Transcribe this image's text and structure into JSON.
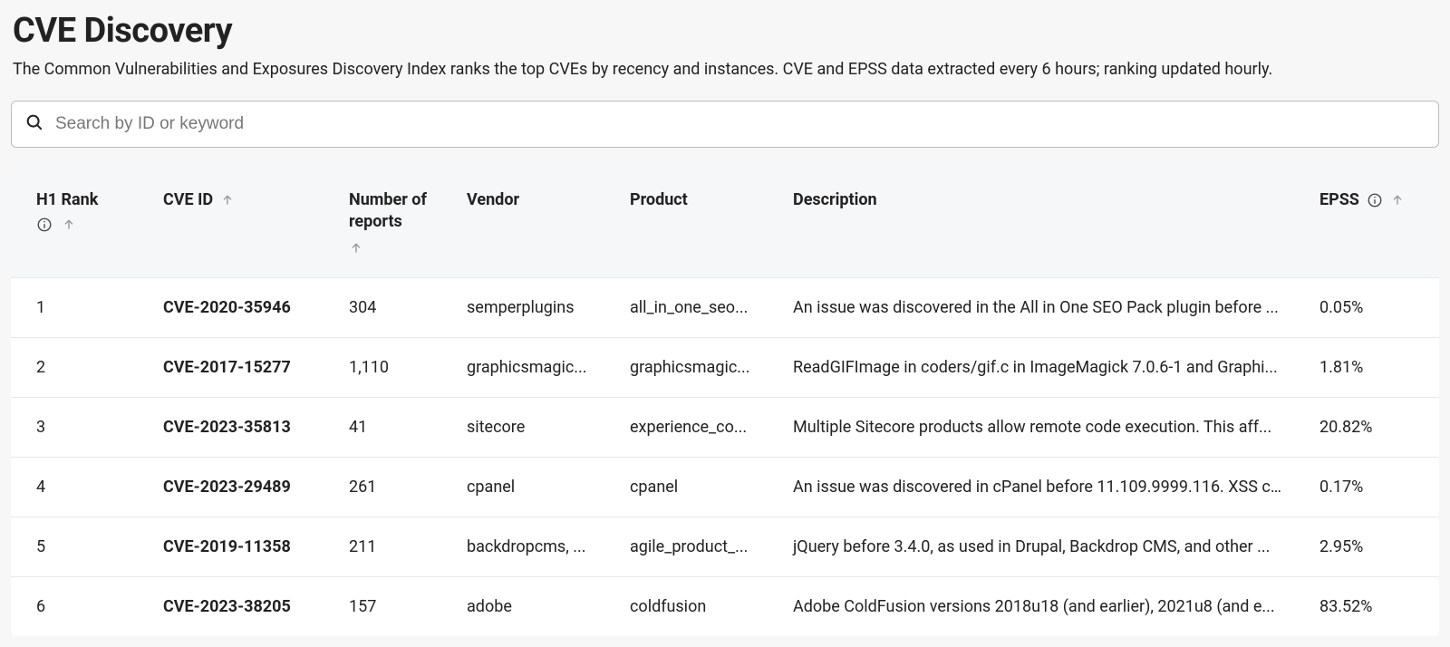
{
  "page": {
    "title": "CVE Discovery",
    "subtitle": "The Common Vulnerabilities and Exposures Discovery Index ranks the top CVEs by recency and instances. CVE and EPSS data extracted every 6 hours; ranking updated hourly."
  },
  "search": {
    "placeholder": "Search by ID or keyword",
    "value": ""
  },
  "columns": {
    "rank": "H1 Rank",
    "cve": "CVE ID",
    "reports": "Number of reports",
    "vendor": "Vendor",
    "product": "Product",
    "description": "Description",
    "epss": "EPSS"
  },
  "rows": [
    {
      "rank": "1",
      "cve": "CVE-2020-35946",
      "reports": "304",
      "vendor": "semperplugins",
      "product": "all_in_one_seo...",
      "description": "An issue was discovered in the All in One SEO Pack plugin before ...",
      "epss": "0.05%"
    },
    {
      "rank": "2",
      "cve": "CVE-2017-15277",
      "reports": "1,110",
      "vendor": "graphicsmagic...",
      "product": "graphicsmagic...",
      "description": "ReadGIFImage in coders/gif.c in ImageMagick 7.0.6-1 and Graphi...",
      "epss": "1.81%"
    },
    {
      "rank": "3",
      "cve": "CVE-2023-35813",
      "reports": "41",
      "vendor": "sitecore",
      "product": "experience_co...",
      "description": "Multiple Sitecore products allow remote code execution. This aff...",
      "epss": "20.82%"
    },
    {
      "rank": "4",
      "cve": "CVE-2023-29489",
      "reports": "261",
      "vendor": "cpanel",
      "product": "cpanel",
      "description": "An issue was discovered in cPanel before 11.109.9999.116. XSS c...",
      "epss": "0.17%"
    },
    {
      "rank": "5",
      "cve": "CVE-2019-11358",
      "reports": "211",
      "vendor": "backdropcms, ...",
      "product": "agile_product_...",
      "description": "jQuery before 3.4.0, as used in Drupal, Backdrop CMS, and other ...",
      "epss": "2.95%"
    },
    {
      "rank": "6",
      "cve": "CVE-2023-38205",
      "reports": "157",
      "vendor": "adobe",
      "product": "coldfusion",
      "description": "Adobe ColdFusion versions 2018u18 (and earlier), 2021u8 (and e...",
      "epss": "83.52%"
    }
  ]
}
